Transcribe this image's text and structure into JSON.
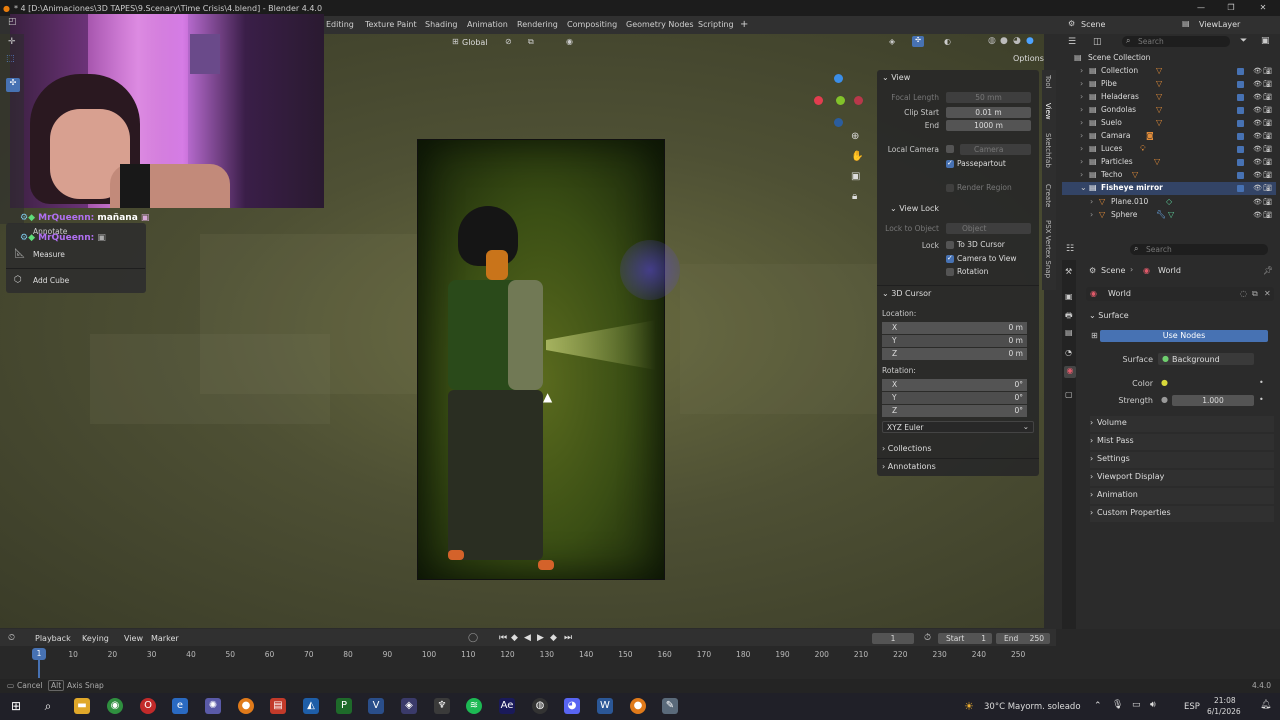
{
  "window": {
    "title": "* 4 [D:\\Animaciones\\3D TAPES\\9.Scenary\\Time Crisis\\4.blend] - Blender 4.4.0",
    "min": "—",
    "max": "❐",
    "close": "✕"
  },
  "workspaces": [
    "Editing",
    "Texture Paint",
    "Shading",
    "Animation",
    "Rendering",
    "Compositing",
    "Geometry Nodes",
    "Scripting",
    "+"
  ],
  "header": {
    "scene_label": "Scene",
    "viewlayer_label": "ViewLayer",
    "transform_orientation": "Global"
  },
  "viewport": {
    "options_label": "Options"
  },
  "chat": {
    "user": "MrQueenn:",
    "message1": "mañana",
    "message2": ""
  },
  "toolbar": {
    "annotate": "Annotate",
    "measure": "Measure",
    "add_cube": "Add Cube"
  },
  "npanel": {
    "view_header": "View",
    "focal_length_label": "Focal Length",
    "focal_length": "50 mm",
    "clip_start_label": "Clip Start",
    "clip_start": "0.01 m",
    "end_label": "End",
    "end": "1000 m",
    "local_camera_label": "Local Camera",
    "local_camera": "Camera",
    "passepartout": "Passepartout",
    "render_region": "Render Region",
    "view_lock_header": "View Lock",
    "lock_to_object_label": "Lock to Object",
    "lock_to_object": "Object",
    "lock_label": "Lock",
    "to_3d_cursor": "To 3D Cursor",
    "camera_to_view": "Camera to View",
    "rotation_opt": "Rotation",
    "cursor_header": "3D Cursor",
    "location_label": "Location:",
    "rotation_label": "Rotation:",
    "x": "X",
    "y": "Y",
    "z": "Z",
    "loc_x": "0 m",
    "loc_y": "0 m",
    "loc_z": "0 m",
    "rot_x": "0°",
    "rot_y": "0°",
    "rot_z": "0°",
    "rot_mode": "XYZ Euler",
    "collections": "Collections",
    "annotations": "Annotations"
  },
  "sidetabs": [
    "Tool",
    "View",
    "Sketchfab",
    "Create",
    "PSX Vertex Snap"
  ],
  "outliner": {
    "search_placeholder": "Search",
    "root": "Scene Collection",
    "items": [
      "Collection",
      "Pibe",
      "Heladeras",
      "Gondolas",
      "Suelo",
      "Camara",
      "Luces",
      "Particles",
      "Techo",
      "Fisheye mirror"
    ],
    "children": [
      "Plane.010",
      "Sphere"
    ]
  },
  "properties": {
    "search_placeholder": "Search",
    "breadcrumb_scene": "Scene",
    "breadcrumb_world": "World",
    "world_name": "World",
    "surface_header": "Surface",
    "use_nodes": "Use Nodes",
    "surface_label": "Surface",
    "surface_value": "Background",
    "color_label": "Color",
    "strength_label": "Strength",
    "strength_value": "1.000",
    "sections": [
      "Volume",
      "Mist Pass",
      "Settings",
      "Viewport Display",
      "Animation",
      "Custom Properties"
    ]
  },
  "timeline": {
    "playback": "Playback",
    "keying": "Keying",
    "view": "View",
    "marker": "Marker",
    "current_frame": "1",
    "start_label": "Start",
    "start": "1",
    "end_label": "End",
    "end": "250",
    "frame_indicator": "1",
    "ticks": [
      "10",
      "20",
      "30",
      "40",
      "50",
      "60",
      "70",
      "80",
      "90",
      "100",
      "110",
      "120",
      "130",
      "140",
      "150",
      "160",
      "170",
      "180",
      "190",
      "200",
      "210",
      "220",
      "230",
      "240",
      "250"
    ]
  },
  "status": {
    "cancel": "Cancel",
    "alt": "Alt",
    "axis_snap": "Axis Snap",
    "version": "4.4.0"
  },
  "taskbar": {
    "weather": "30°C  Mayorm. soleado",
    "lang": "ESP",
    "time": "21:08",
    "date": "6/1/2026"
  }
}
